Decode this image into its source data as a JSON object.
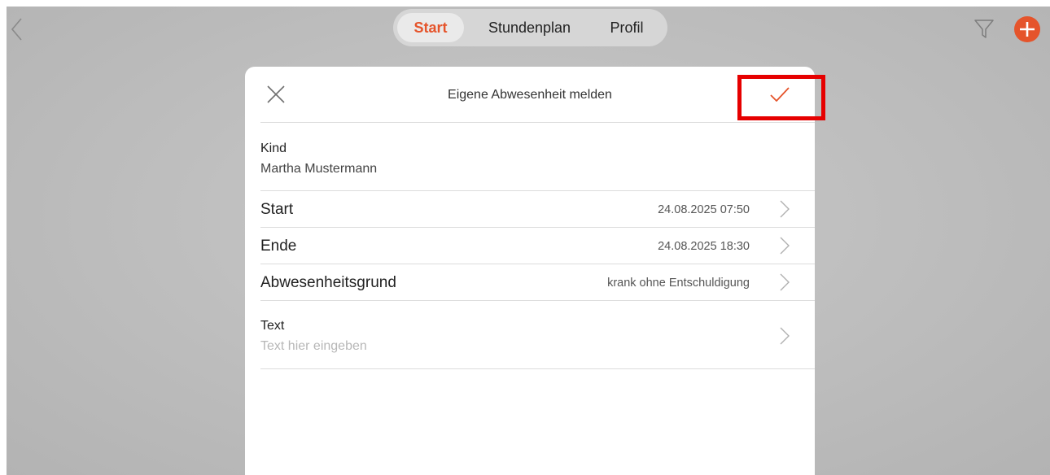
{
  "nav": {
    "tabs": [
      "Start",
      "Stundenplan",
      "Profil"
    ],
    "active_tab": "Start",
    "accent_color": "#e5542b"
  },
  "icons": {
    "back": "chevron-left-icon",
    "filter": "filter-icon",
    "add": "plus-circle-icon",
    "close": "close-icon",
    "confirm": "checkmark-icon",
    "row": "chevron-right-icon"
  },
  "sheet": {
    "title": "Eigene Abwesenheit melden",
    "kind": {
      "label": "Kind",
      "value": "Martha Mustermann"
    },
    "rows": [
      {
        "label": "Start",
        "value": "24.08.2025 07:50"
      },
      {
        "label": "Ende",
        "value": "24.08.2025 18:30"
      },
      {
        "label": "Abwesenheitsgrund",
        "value": "krank ohne Entschuldigung"
      }
    ],
    "text": {
      "label": "Text",
      "placeholder": "Text hier eingeben"
    }
  },
  "highlight_color": "#e60000"
}
